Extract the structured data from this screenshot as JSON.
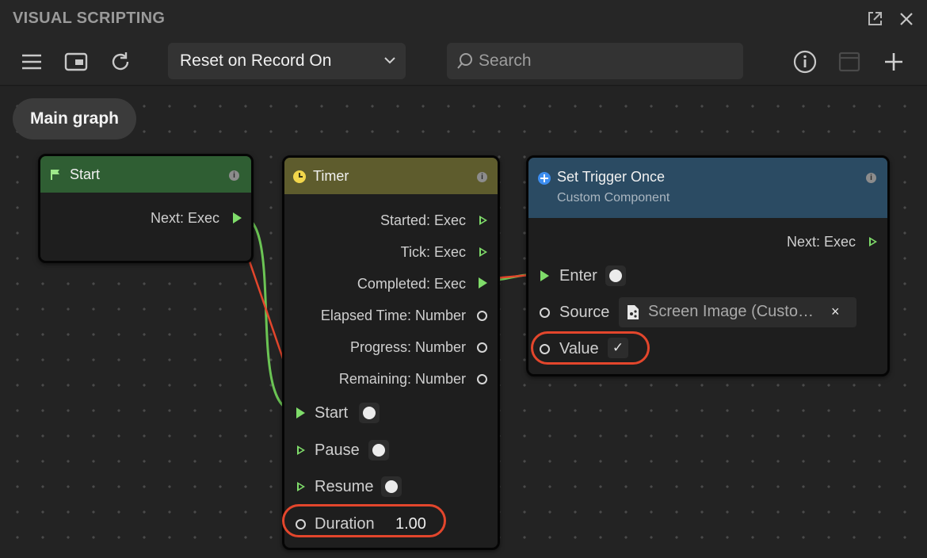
{
  "window": {
    "title": "VISUAL SCRIPTING",
    "popout_icon": "popout-icon",
    "close_icon": "close-icon"
  },
  "toolbar": {
    "menu_icon": "hamburger-menu-icon",
    "panel_icon": "panel-toggle-icon",
    "refresh_icon": "refresh-icon",
    "dropdown_value": "Reset on Record On",
    "search_placeholder": "Search",
    "info_icon": "info-icon",
    "window_icon": "window-icon",
    "add_icon": "plus-icon"
  },
  "breadcrumb": {
    "label": "Main graph"
  },
  "nodes": {
    "start": {
      "title": "Start",
      "header_color": "#2f5e33",
      "outputs": [
        "Next: Exec"
      ]
    },
    "timer": {
      "title": "Timer",
      "header_color": "#5e5c2d",
      "outputs": [
        "Started: Exec",
        "Tick: Exec",
        "Completed: Exec",
        "Elapsed Time: Number",
        "Progress: Number",
        "Remaining: Number"
      ],
      "inputs": [
        "Start",
        "Pause",
        "Resume",
        "Duration"
      ],
      "duration_value": "1.00"
    },
    "set_trigger": {
      "title": "Set Trigger Once",
      "subtitle": "Custom Component",
      "header_color": "#2b4b63",
      "outputs": [
        "Next: Exec"
      ],
      "inputs": [
        "Enter",
        "Source",
        "Value"
      ],
      "source_value": "Screen Image (Custo…",
      "source_clear": "×",
      "value_check": "✓"
    }
  },
  "colors": {
    "exec_port": "#7fdc6a",
    "wire": "#6bc454",
    "annotation": "#e3462c",
    "info_accent": "#3d8ef0"
  }
}
